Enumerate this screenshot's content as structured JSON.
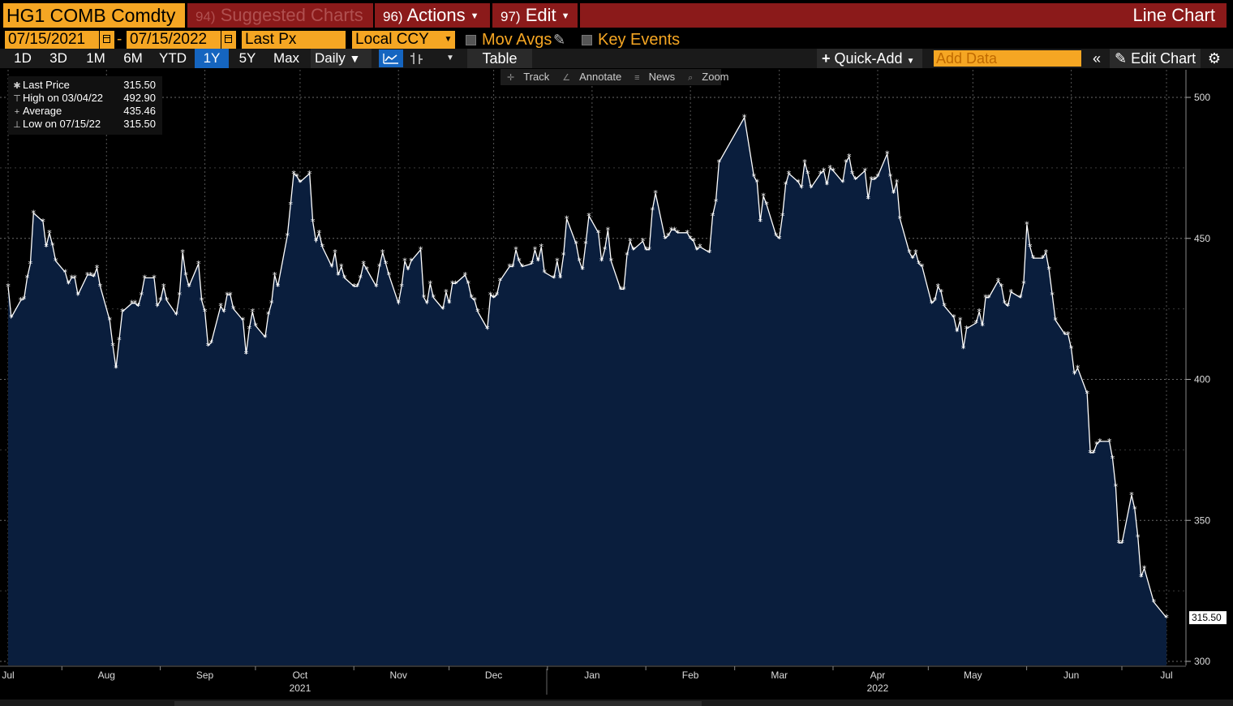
{
  "header": {
    "ticker": "HG1 COMB Comdty",
    "suggested_num": "94)",
    "suggested_label": "Suggested Charts",
    "actions_num": "96)",
    "actions_label": "Actions",
    "edit_num": "97)",
    "edit_label": "Edit",
    "chart_type_label": "Line Chart"
  },
  "controls": {
    "date_from": "07/15/2021",
    "date_to": "07/15/2022",
    "date_sep": "-",
    "field": "Last Px",
    "currency": "Local CCY",
    "mov_avgs": "Mov Avgs",
    "key_events": "Key Events"
  },
  "toolbar": {
    "periods": [
      "1D",
      "3D",
      "1M",
      "6M",
      "YTD",
      "1Y",
      "5Y",
      "Max"
    ],
    "selected_period": "1Y",
    "frequency": "Daily",
    "table": "Table",
    "quick_add": "Quick-Add",
    "add_data_placeholder": "Add Data",
    "edit_chart": "Edit Chart"
  },
  "tools": {
    "track": "Track",
    "annotate": "Annotate",
    "news": "News",
    "zoom": "Zoom"
  },
  "legend": {
    "last_label": "Last Price",
    "last_value": "315.50",
    "high_label": "High on 03/04/22",
    "high_value": "492.90",
    "avg_label": "Average",
    "avg_value": "435.46",
    "low_label": "Low on 07/15/22",
    "low_value": "315.50"
  },
  "colors": {
    "accent_orange": "#f5a623",
    "title_red": "#8b1a1a",
    "area_fill": "#0a1e3d",
    "line": "#ffffff",
    "selected_blue": "#1565c0"
  },
  "chart_data": {
    "type": "area",
    "title": "",
    "xlabel": "",
    "ylabel": "",
    "ylim": [
      300,
      500
    ],
    "yticks": [
      300,
      350,
      400,
      450,
      500
    ],
    "last_value_label": "315.50",
    "months": [
      "Jul",
      "Aug",
      "Sep",
      "Oct",
      "Nov",
      "Dec",
      "Jan",
      "Feb",
      "Mar",
      "Apr",
      "May",
      "Jun",
      "Jul"
    ],
    "month_dates": [
      "2021-07-15",
      "2021-08-15",
      "2021-09-15",
      "2021-10-15",
      "2021-11-15",
      "2021-12-15",
      "2022-01-15",
      "2022-02-15",
      "2022-03-15",
      "2022-04-15",
      "2022-05-15",
      "2022-06-15",
      "2022-07-15"
    ],
    "years": [
      {
        "label": "2021",
        "date": "2021-10-15"
      },
      {
        "label": "2022",
        "date": "2022-04-15"
      }
    ],
    "series": [
      {
        "points": [
          [
            "2021-07-15",
            433.0
          ],
          [
            "2021-07-16",
            422.0
          ],
          [
            "2021-07-19",
            428.0
          ],
          [
            "2021-07-20",
            428.5
          ],
          [
            "2021-07-21",
            436.0
          ],
          [
            "2021-07-22",
            441.0
          ],
          [
            "2021-07-23",
            459.0
          ],
          [
            "2021-07-26",
            456.0
          ],
          [
            "2021-07-27",
            447.0
          ],
          [
            "2021-07-28",
            452.0
          ],
          [
            "2021-07-29",
            447.5
          ],
          [
            "2021-07-30",
            442.0
          ],
          [
            "2021-08-02",
            438.0
          ],
          [
            "2021-08-03",
            434.0
          ],
          [
            "2021-08-04",
            436.0
          ],
          [
            "2021-08-05",
            436.0
          ],
          [
            "2021-08-06",
            430.0
          ],
          [
            "2021-08-09",
            437.0
          ],
          [
            "2021-08-10",
            437.0
          ],
          [
            "2021-08-11",
            436.5
          ],
          [
            "2021-08-12",
            439.5
          ],
          [
            "2021-08-13",
            433.0
          ],
          [
            "2021-08-16",
            421.0
          ],
          [
            "2021-08-17",
            412.0
          ],
          [
            "2021-08-18",
            404.0
          ],
          [
            "2021-08-19",
            414.0
          ],
          [
            "2021-08-20",
            424.0
          ],
          [
            "2021-08-23",
            427.0
          ],
          [
            "2021-08-24",
            427.0
          ],
          [
            "2021-08-25",
            426.0
          ],
          [
            "2021-08-26",
            430.0
          ],
          [
            "2021-08-27",
            436.0
          ],
          [
            "2021-08-30",
            436.0
          ],
          [
            "2021-08-31",
            426.0
          ],
          [
            "2021-09-01",
            428.0
          ],
          [
            "2021-09-02",
            433.0
          ],
          [
            "2021-09-03",
            428.0
          ],
          [
            "2021-09-06",
            423.0
          ],
          [
            "2021-09-07",
            430.0
          ],
          [
            "2021-09-08",
            445.0
          ],
          [
            "2021-09-09",
            437.0
          ],
          [
            "2021-09-10",
            433.0
          ],
          [
            "2021-09-13",
            441.0
          ],
          [
            "2021-09-14",
            428.0
          ],
          [
            "2021-09-15",
            424.0
          ],
          [
            "2021-09-16",
            412.0
          ],
          [
            "2021-09-17",
            413.0
          ],
          [
            "2021-09-20",
            426.0
          ],
          [
            "2021-09-21",
            424.0
          ],
          [
            "2021-09-22",
            430.0
          ],
          [
            "2021-09-23",
            430.0
          ],
          [
            "2021-09-24",
            425.0
          ],
          [
            "2021-09-27",
            421.0
          ],
          [
            "2021-09-28",
            409.0
          ],
          [
            "2021-09-29",
            418.0
          ],
          [
            "2021-09-30",
            424.0
          ],
          [
            "2021-10-01",
            419.0
          ],
          [
            "2021-10-04",
            415.0
          ],
          [
            "2021-10-05",
            423.0
          ],
          [
            "2021-10-06",
            427.0
          ],
          [
            "2021-10-07",
            437.0
          ],
          [
            "2021-10-08",
            433.0
          ],
          [
            "2021-10-11",
            451.0
          ],
          [
            "2021-10-12",
            462.0
          ],
          [
            "2021-10-13",
            473.0
          ],
          [
            "2021-10-14",
            472.0
          ],
          [
            "2021-10-15",
            470.0
          ],
          [
            "2021-10-18",
            473.0
          ],
          [
            "2021-10-19",
            456.0
          ],
          [
            "2021-10-20",
            449.0
          ],
          [
            "2021-10-21",
            452.0
          ],
          [
            "2021-10-22",
            447.0
          ],
          [
            "2021-10-25",
            440.0
          ],
          [
            "2021-10-26",
            445.0
          ],
          [
            "2021-10-27",
            437.0
          ],
          [
            "2021-10-28",
            440.0
          ],
          [
            "2021-10-29",
            436.0
          ],
          [
            "2021-11-01",
            433.0
          ],
          [
            "2021-11-02",
            433.0
          ],
          [
            "2021-11-03",
            436.0
          ],
          [
            "2021-11-04",
            441.0
          ],
          [
            "2021-11-05",
            439.0
          ],
          [
            "2021-11-08",
            433.0
          ],
          [
            "2021-11-09",
            440.0
          ],
          [
            "2021-11-10",
            445.0
          ],
          [
            "2021-11-11",
            441.0
          ],
          [
            "2021-11-12",
            437.0
          ],
          [
            "2021-11-15",
            427.0
          ],
          [
            "2021-11-16",
            433.0
          ],
          [
            "2021-11-17",
            442.0
          ],
          [
            "2021-11-18",
            439.0
          ],
          [
            "2021-11-19",
            442.0
          ],
          [
            "2021-11-22",
            446.0
          ],
          [
            "2021-11-23",
            429.0
          ],
          [
            "2021-11-24",
            427.0
          ],
          [
            "2021-11-25",
            434.0
          ],
          [
            "2021-11-26",
            429.0
          ],
          [
            "2021-11-29",
            425.0
          ],
          [
            "2021-11-30",
            431.0
          ],
          [
            "2021-12-01",
            427.0
          ],
          [
            "2021-12-02",
            434.0
          ],
          [
            "2021-12-03",
            434.0
          ],
          [
            "2021-12-06",
            437.0
          ],
          [
            "2021-12-07",
            434.0
          ],
          [
            "2021-12-08",
            429.0
          ],
          [
            "2021-12-09",
            428.0
          ],
          [
            "2021-12-10",
            424.0
          ],
          [
            "2021-12-13",
            418.0
          ],
          [
            "2021-12-14",
            430.0
          ],
          [
            "2021-12-15",
            429.0
          ],
          [
            "2021-12-16",
            430.0
          ],
          [
            "2021-12-17",
            435.0
          ],
          [
            "2021-12-20",
            440.0
          ],
          [
            "2021-12-21",
            440.0
          ],
          [
            "2021-12-22",
            446.0
          ],
          [
            "2021-12-23",
            442.0
          ],
          [
            "2021-12-24",
            440.0
          ],
          [
            "2021-12-27",
            441.0
          ],
          [
            "2021-12-28",
            446.0
          ],
          [
            "2021-12-29",
            442.0
          ],
          [
            "2021-12-30",
            447.0
          ],
          [
            "2021-12-31",
            438.0
          ],
          [
            "2022-01-03",
            436.0
          ],
          [
            "2022-01-04",
            442.0
          ],
          [
            "2022-01-05",
            436.0
          ],
          [
            "2022-01-06",
            444.0
          ],
          [
            "2022-01-07",
            457.0
          ],
          [
            "2022-01-10",
            448.0
          ],
          [
            "2022-01-11",
            442.0
          ],
          [
            "2022-01-12",
            439.0
          ],
          [
            "2022-01-13",
            448.0
          ],
          [
            "2022-01-14",
            458.0
          ],
          [
            "2022-01-17",
            452.0
          ],
          [
            "2022-01-18",
            442.0
          ],
          [
            "2022-01-19",
            446.0
          ],
          [
            "2022-01-20",
            453.0
          ],
          [
            "2022-01-21",
            442.0
          ],
          [
            "2022-01-24",
            432.0
          ],
          [
            "2022-01-25",
            432.0
          ],
          [
            "2022-01-26",
            444.0
          ],
          [
            "2022-01-27",
            449.0
          ],
          [
            "2022-01-28",
            446.0
          ],
          [
            "2022-01-31",
            449.0
          ],
          [
            "2022-02-01",
            446.0
          ],
          [
            "2022-02-02",
            446.0
          ],
          [
            "2022-02-03",
            460.0
          ],
          [
            "2022-02-04",
            466.0
          ],
          [
            "2022-02-07",
            450.0
          ],
          [
            "2022-02-08",
            451.0
          ],
          [
            "2022-02-09",
            453.0
          ],
          [
            "2022-02-10",
            453.0
          ],
          [
            "2022-02-11",
            452.0
          ],
          [
            "2022-02-14",
            452.0
          ],
          [
            "2022-02-15",
            450.0
          ],
          [
            "2022-02-16",
            449.0
          ],
          [
            "2022-02-17",
            446.0
          ],
          [
            "2022-02-18",
            447.0
          ],
          [
            "2022-02-21",
            445.0
          ],
          [
            "2022-02-22",
            458.0
          ],
          [
            "2022-02-23",
            463.0
          ],
          [
            "2022-02-24",
            477.0
          ],
          [
            "2022-03-04",
            492.9
          ],
          [
            "2022-03-07",
            472.0
          ],
          [
            "2022-03-08",
            470.0
          ],
          [
            "2022-03-09",
            456.0
          ],
          [
            "2022-03-10",
            465.0
          ],
          [
            "2022-03-11",
            462.0
          ],
          [
            "2022-03-14",
            451.0
          ],
          [
            "2022-03-15",
            450.0
          ],
          [
            "2022-03-16",
            458.0
          ],
          [
            "2022-03-17",
            469.0
          ],
          [
            "2022-03-18",
            473.0
          ],
          [
            "2022-03-21",
            470.0
          ],
          [
            "2022-03-22",
            468.0
          ],
          [
            "2022-03-23",
            477.0
          ],
          [
            "2022-03-24",
            473.0
          ],
          [
            "2022-03-25",
            468.0
          ],
          [
            "2022-03-28",
            473.0
          ],
          [
            "2022-03-29",
            474.0
          ],
          [
            "2022-03-30",
            469.0
          ],
          [
            "2022-03-31",
            475.0
          ],
          [
            "2022-04-01",
            474.0
          ],
          [
            "2022-04-04",
            470.0
          ],
          [
            "2022-04-05",
            477.0
          ],
          [
            "2022-04-06",
            479.0
          ],
          [
            "2022-04-07",
            473.0
          ],
          [
            "2022-04-08",
            471.0
          ],
          [
            "2022-04-11",
            474.0
          ],
          [
            "2022-04-12",
            464.0
          ],
          [
            "2022-04-13",
            471.0
          ],
          [
            "2022-04-14",
            471.0
          ],
          [
            "2022-04-15",
            472.0
          ],
          [
            "2022-04-18",
            480.0
          ],
          [
            "2022-04-19",
            472.0
          ],
          [
            "2022-04-20",
            466.0
          ],
          [
            "2022-04-21",
            470.0
          ],
          [
            "2022-04-22",
            457.0
          ],
          [
            "2022-04-25",
            445.0
          ],
          [
            "2022-04-26",
            443.0
          ],
          [
            "2022-04-27",
            445.0
          ],
          [
            "2022-04-28",
            441.0
          ],
          [
            "2022-04-29",
            440.0
          ],
          [
            "2022-05-02",
            427.0
          ],
          [
            "2022-05-03",
            428.0
          ],
          [
            "2022-05-04",
            433.0
          ],
          [
            "2022-05-05",
            431.0
          ],
          [
            "2022-05-06",
            426.0
          ],
          [
            "2022-05-09",
            422.0
          ],
          [
            "2022-05-10",
            417.0
          ],
          [
            "2022-05-11",
            421.0
          ],
          [
            "2022-05-12",
            411.0
          ],
          [
            "2022-05-13",
            418.0
          ],
          [
            "2022-05-16",
            420.0
          ],
          [
            "2022-05-17",
            424.0
          ],
          [
            "2022-05-18",
            419.0
          ],
          [
            "2022-05-19",
            429.0
          ],
          [
            "2022-05-20",
            429.0
          ],
          [
            "2022-05-23",
            435.0
          ],
          [
            "2022-05-24",
            433.0
          ],
          [
            "2022-05-25",
            427.0
          ],
          [
            "2022-05-26",
            426.0
          ],
          [
            "2022-05-27",
            431.0
          ],
          [
            "2022-05-30",
            429.0
          ],
          [
            "2022-05-31",
            434.0
          ],
          [
            "2022-06-01",
            455.0
          ],
          [
            "2022-06-02",
            447.0
          ],
          [
            "2022-06-03",
            443.0
          ],
          [
            "2022-06-06",
            443.0
          ],
          [
            "2022-06-07",
            445.0
          ],
          [
            "2022-06-08",
            439.0
          ],
          [
            "2022-06-09",
            430.0
          ],
          [
            "2022-06-10",
            421.0
          ],
          [
            "2022-06-13",
            416.0
          ],
          [
            "2022-06-14",
            416.0
          ],
          [
            "2022-06-15",
            411.0
          ],
          [
            "2022-06-16",
            402.0
          ],
          [
            "2022-06-17",
            404.0
          ],
          [
            "2022-06-20",
            395.0
          ],
          [
            "2022-06-21",
            374.0
          ],
          [
            "2022-06-22",
            374.0
          ],
          [
            "2022-06-23",
            377.0
          ],
          [
            "2022-06-24",
            378.0
          ],
          [
            "2022-06-27",
            378.0
          ],
          [
            "2022-06-28",
            372.0
          ],
          [
            "2022-06-29",
            362.0
          ],
          [
            "2022-06-30",
            342.0
          ],
          [
            "2022-07-01",
            342.0
          ],
          [
            "2022-07-04",
            359.0
          ],
          [
            "2022-07-05",
            354.0
          ],
          [
            "2022-07-06",
            344.0
          ],
          [
            "2022-07-07",
            330.0
          ],
          [
            "2022-07-08",
            333.0
          ],
          [
            "2022-07-11",
            321.0
          ],
          [
            "2022-07-15",
            315.5
          ]
        ]
      }
    ]
  }
}
